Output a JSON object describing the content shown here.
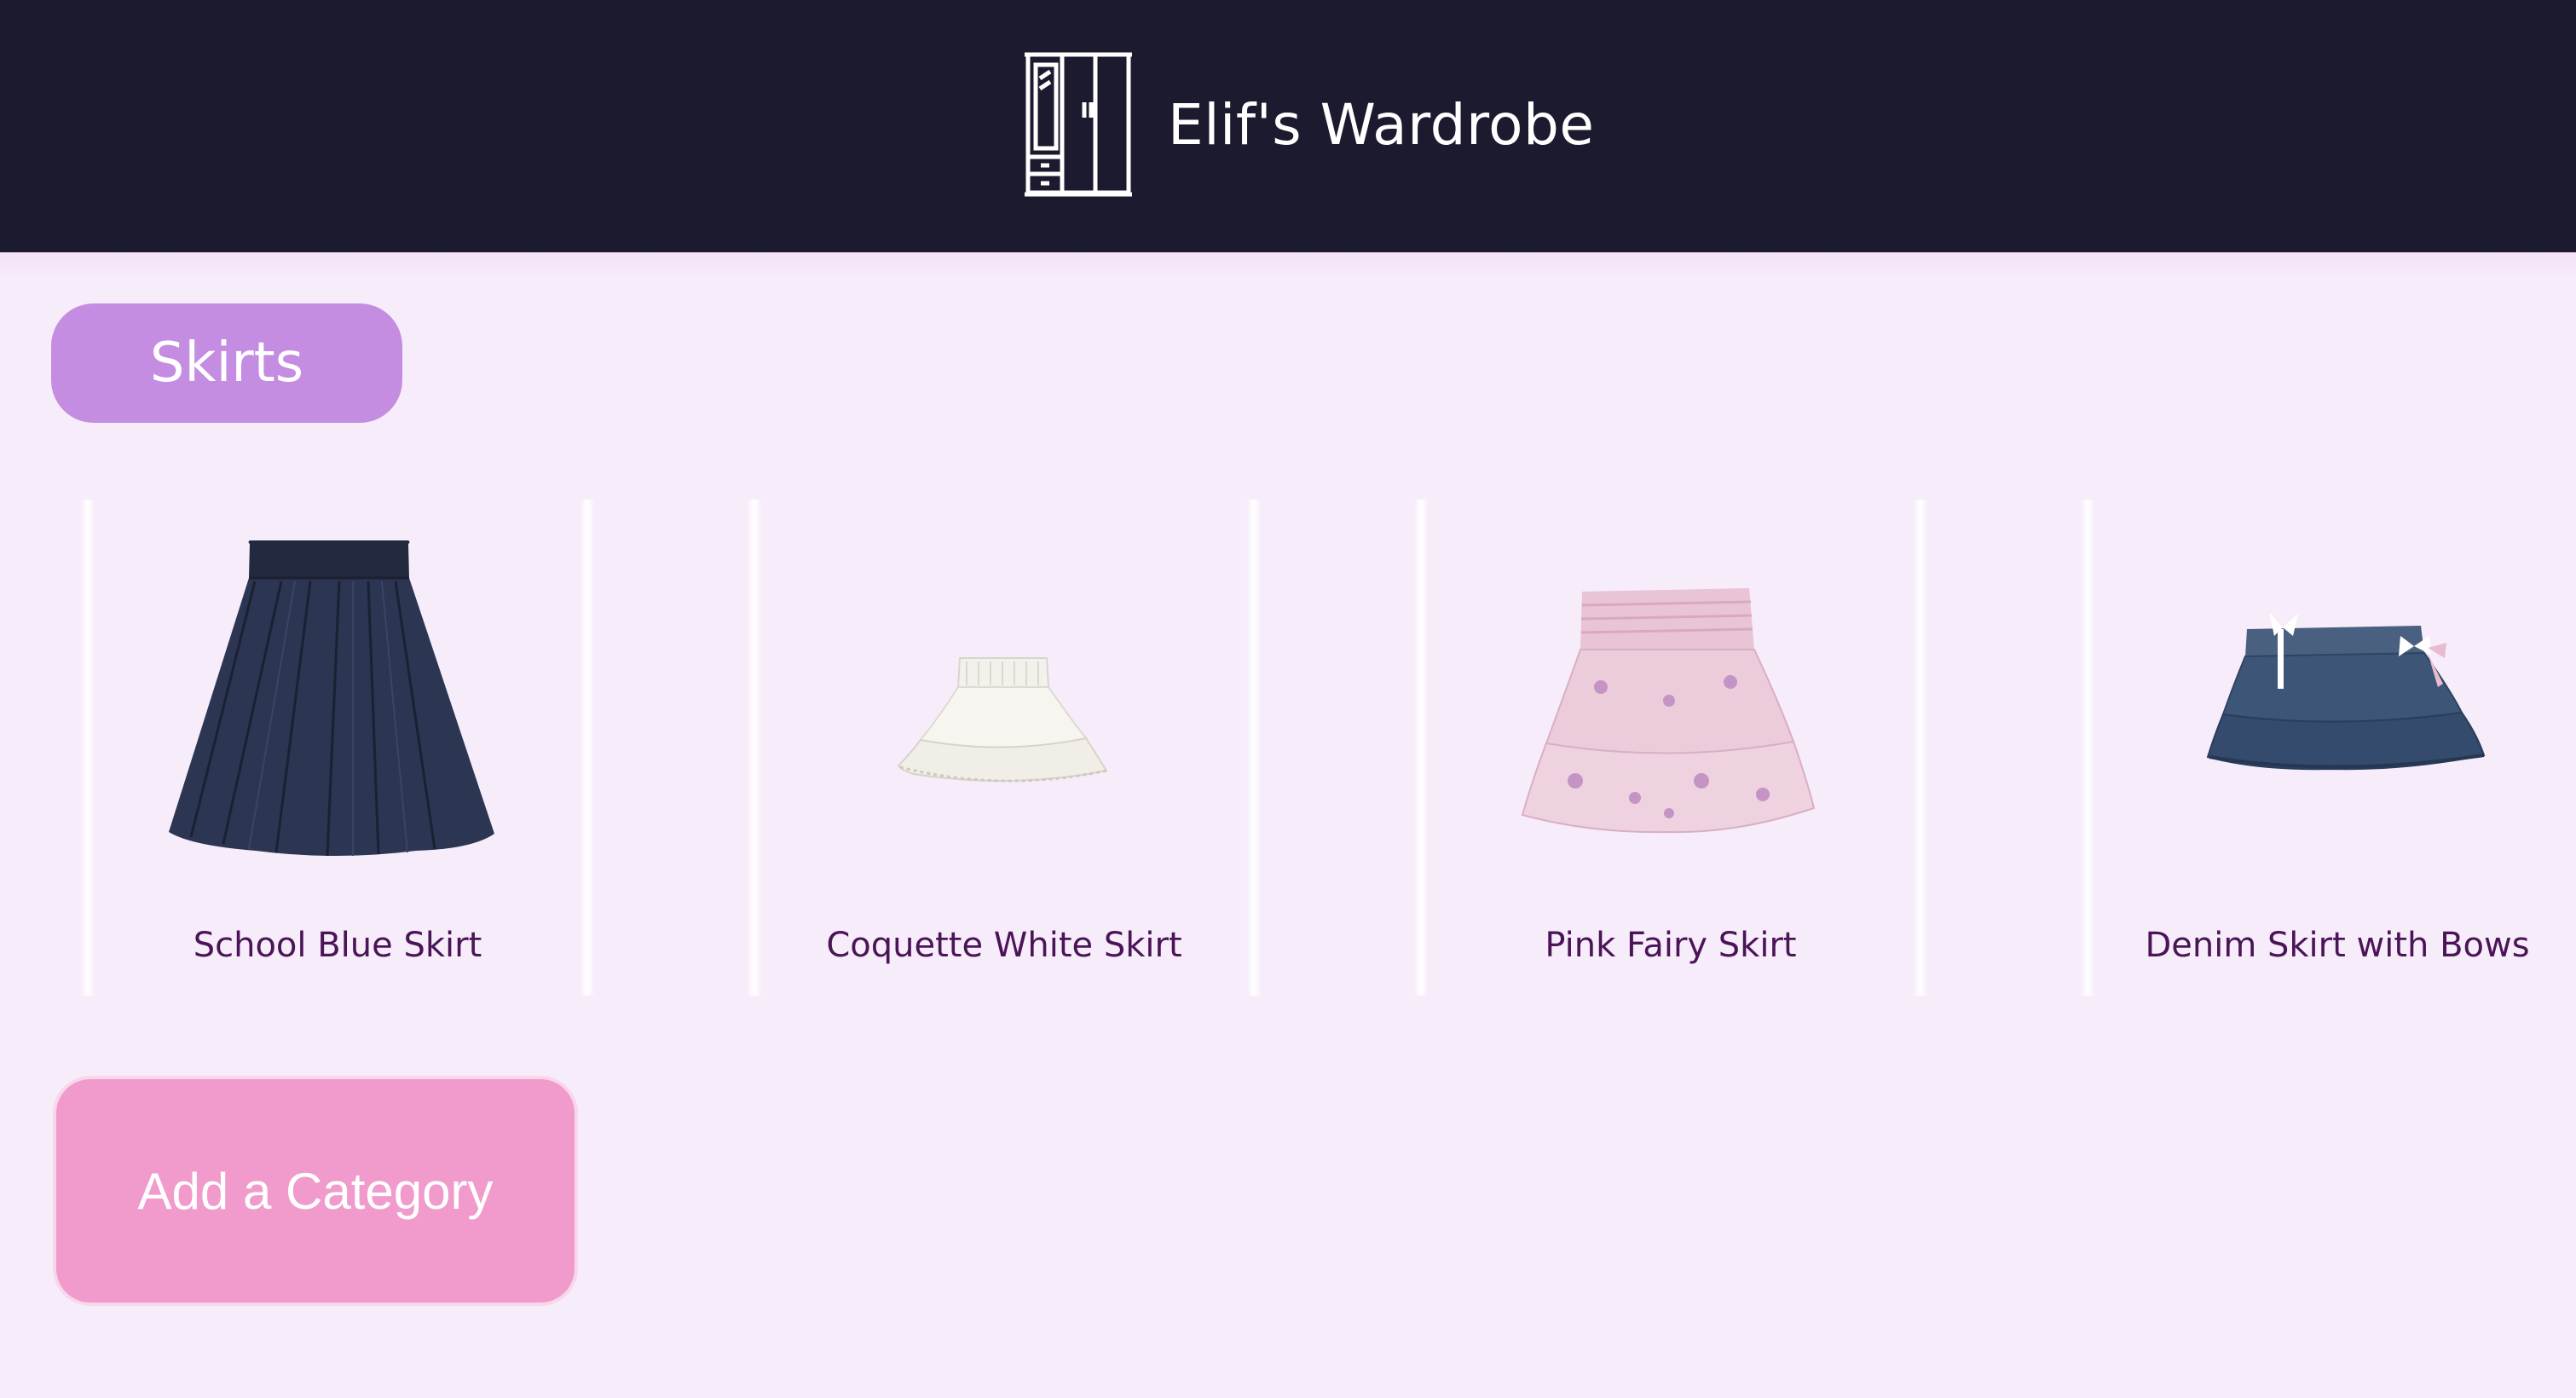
{
  "header": {
    "title": "Elif's Wardrobe",
    "icon": "wardrobe-icon",
    "background": "#1c1a2e"
  },
  "category": {
    "label": "Skirts",
    "color": "#c48de2"
  },
  "items": [
    {
      "label": "School Blue Skirt",
      "icon": "navy-pleated-skirt-image"
    },
    {
      "label": "Coquette White Skirt",
      "icon": "white-ruffle-skirt-image"
    },
    {
      "label": "Pink Fairy Skirt",
      "icon": "pink-floral-skirt-image"
    },
    {
      "label": "Denim Skirt with Bows",
      "icon": "denim-bow-skirt-image"
    }
  ],
  "add_category": {
    "label": "Add a Category",
    "color": "#f09bcb"
  }
}
